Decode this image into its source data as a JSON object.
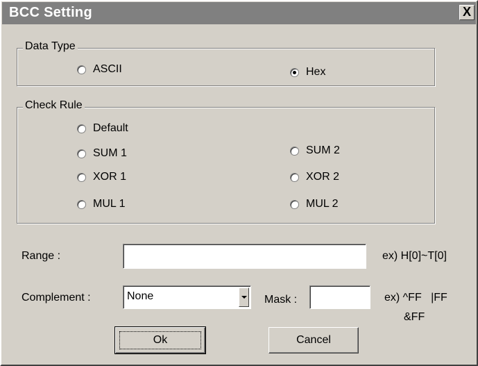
{
  "window": {
    "title": "BCC Setting",
    "close_label": "X"
  },
  "data_type": {
    "legend": "Data Type",
    "options": [
      {
        "label": "ASCII",
        "checked": false
      },
      {
        "label": "Hex",
        "checked": true
      }
    ]
  },
  "check_rule": {
    "legend": "Check Rule",
    "options": [
      {
        "label": "Default",
        "checked": false
      },
      {
        "label": "SUM 1",
        "checked": false
      },
      {
        "label": "SUM 2",
        "checked": false
      },
      {
        "label": "XOR 1",
        "checked": false
      },
      {
        "label": "XOR 2",
        "checked": false
      },
      {
        "label": "MUL 1",
        "checked": false
      },
      {
        "label": "MUL 2",
        "checked": false
      }
    ]
  },
  "range": {
    "label": "Range :",
    "value": "",
    "example": "ex) H[0]~T[0]"
  },
  "complement": {
    "label": "Complement :",
    "selected": "None"
  },
  "mask": {
    "label": "Mask :",
    "value": "",
    "example_line1": "ex) ^FF   |FF",
    "example_line2": "&FF"
  },
  "buttons": {
    "ok": "Ok",
    "cancel": "Cancel"
  }
}
